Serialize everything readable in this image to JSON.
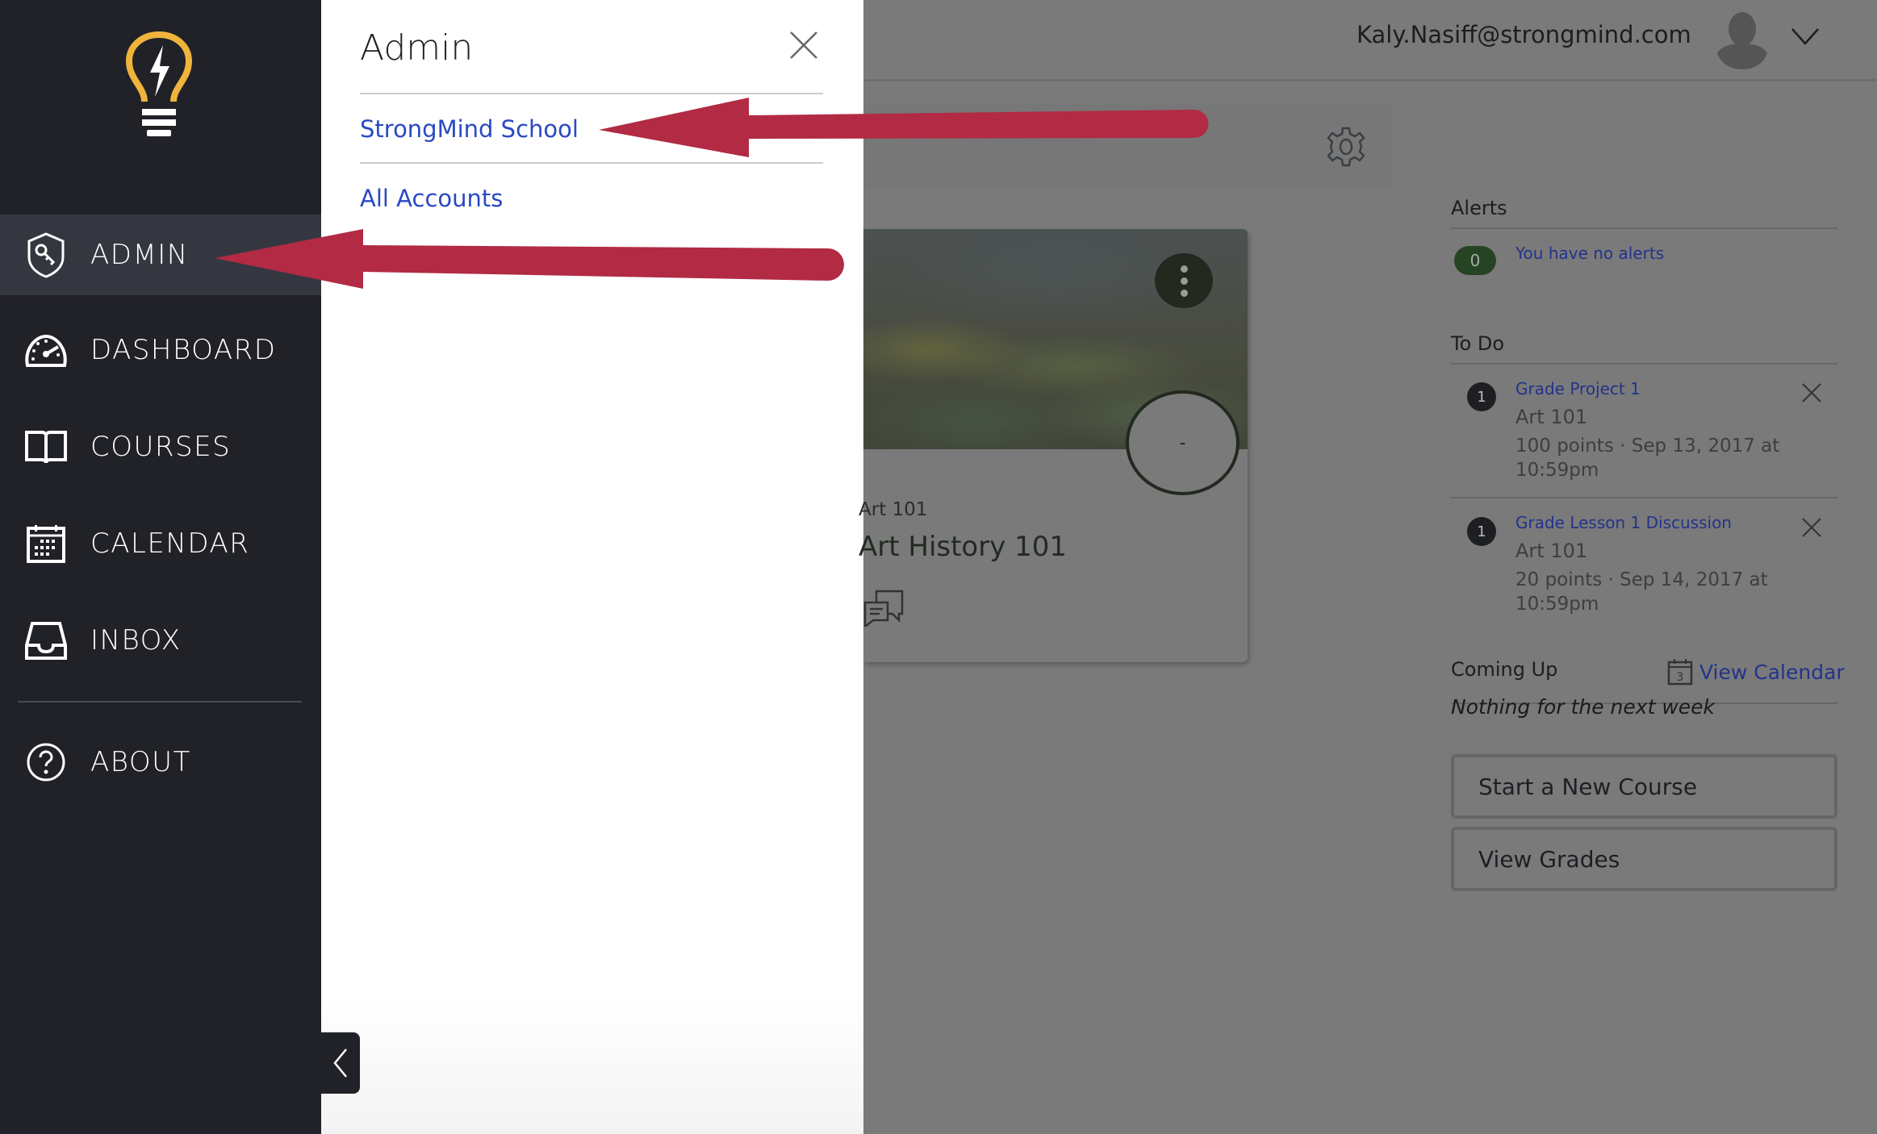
{
  "sidebar": {
    "items": [
      {
        "label": "ADMIN",
        "icon": "shield-key-icon",
        "active": true
      },
      {
        "label": "DASHBOARD",
        "icon": "dashboard-gauge-icon"
      },
      {
        "label": "COURSES",
        "icon": "book-icon"
      },
      {
        "label": "CALENDAR",
        "icon": "calendar-icon"
      },
      {
        "label": "INBOX",
        "icon": "inbox-icon"
      },
      {
        "label": "ABOUT",
        "icon": "help-circle-icon"
      }
    ],
    "collapse_icon": "chevron-left-icon"
  },
  "admin_panel": {
    "title": "Admin",
    "links": [
      "StrongMind School",
      "All Accounts"
    ],
    "close_icon": "close-icon"
  },
  "header": {
    "user_email": "Kaly.Nasiff@strongmind.com"
  },
  "course_card": {
    "code": "Art 101",
    "title": "Art History 101",
    "grade": "-"
  },
  "right_column": {
    "alerts": {
      "heading": "Alerts",
      "count": "0",
      "message": "You have no alerts"
    },
    "todo": {
      "heading": "To Do",
      "items": [
        {
          "count": "1",
          "title": "Grade Project 1",
          "course": "Art 101",
          "meta": "100 points · Sep 13, 2017 at 10:59pm"
        },
        {
          "count": "1",
          "title": "Grade Lesson 1 Discussion",
          "course": "Art 101",
          "meta": "20 points · Sep 14, 2017 at 10:59pm"
        }
      ]
    },
    "coming_up": {
      "heading": "Coming Up",
      "view_calendar": "View Calendar",
      "calendar_day": "3",
      "empty": "Nothing for the next week"
    },
    "buttons": [
      "Start a New Course",
      "View Grades"
    ]
  },
  "colors": {
    "sidebar_bg": "#212228",
    "sidebar_active": "#353740",
    "link_blue": "#2a49c1",
    "logo_yellow": "#f0b43c",
    "arrow_red": "#b22a44",
    "overlay": "#7a7a7a"
  }
}
